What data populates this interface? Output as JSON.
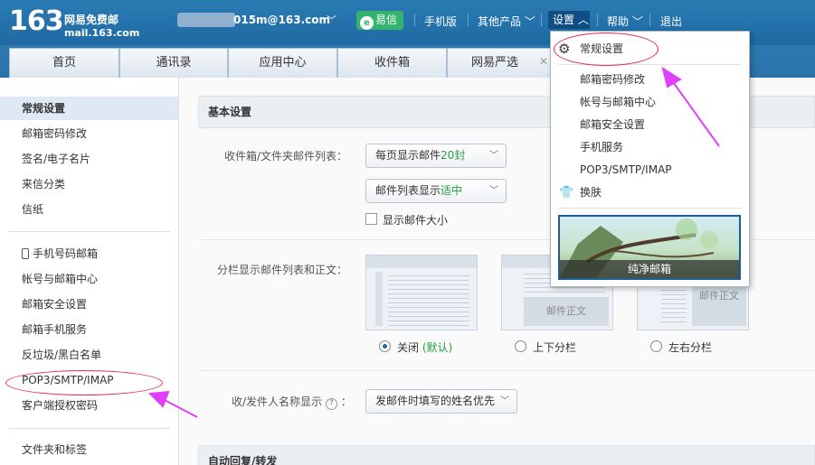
{
  "header": {
    "logo_number": "163",
    "logo_name": "网易免费邮",
    "logo_domain": "mail.163.com",
    "account": "015m@163.com",
    "yixin": "易信",
    "nav": {
      "mobile": "手机版",
      "other": "其他产品",
      "settings": "设置",
      "help": "帮助",
      "logout": "退出"
    }
  },
  "tabs": [
    {
      "label": "首页"
    },
    {
      "label": "通讯录"
    },
    {
      "label": "应用中心"
    },
    {
      "label": "收件箱"
    },
    {
      "label": "网易严选"
    }
  ],
  "sidebar": {
    "items": [
      {
        "label": "常规设置"
      },
      {
        "label": "邮箱密码修改"
      },
      {
        "label": "签名/电子名片"
      },
      {
        "label": "来信分类"
      },
      {
        "label": "信纸"
      },
      {
        "label": "手机号码邮箱"
      },
      {
        "label": "帐号与邮箱中心"
      },
      {
        "label": "邮箱安全设置"
      },
      {
        "label": "邮箱手机服务"
      },
      {
        "label": "反垃圾/黑白名单"
      },
      {
        "label": "POP3/SMTP/IMAP"
      },
      {
        "label": "客户端授权密码"
      },
      {
        "label": "文件夹和标签"
      }
    ]
  },
  "main": {
    "section_basic": "基本设置",
    "label_list": "收件箱/文件夹邮件列表：",
    "select_per_page_prefix": "每页显示邮件",
    "select_per_page_value": "20封",
    "select_density_prefix": "邮件列表显示",
    "select_density_value": "适中",
    "checkbox_size": "显示邮件大小",
    "label_split": "分栏显示邮件列表和正文：",
    "thumb_body": "邮件正文",
    "radio_off": "关闭",
    "radio_default": "(默认)",
    "radio_updown": "上下分栏",
    "radio_leftright": "左右分栏",
    "label_sender": "收/发件人名称显示",
    "select_sender": "发邮件时填写的姓名优先",
    "section_auto": "自动回复/转发"
  },
  "dropdown": {
    "items": [
      {
        "label": "常规设置",
        "icon": "gear-icon"
      },
      {
        "label": "邮箱密码修改"
      },
      {
        "label": "帐号与邮箱中心"
      },
      {
        "label": "邮箱安全设置"
      },
      {
        "label": "手机服务"
      },
      {
        "label": "POP3/SMTP/IMAP"
      },
      {
        "label": "换肤",
        "icon": "tshirt-icon"
      }
    ],
    "skin_label": "纯净邮箱"
  },
  "colors": {
    "header_blue": "#1f6aa4",
    "highlight_pink": "#e8294b",
    "arrow_magenta": "#e040fb",
    "green": "#24a044"
  }
}
